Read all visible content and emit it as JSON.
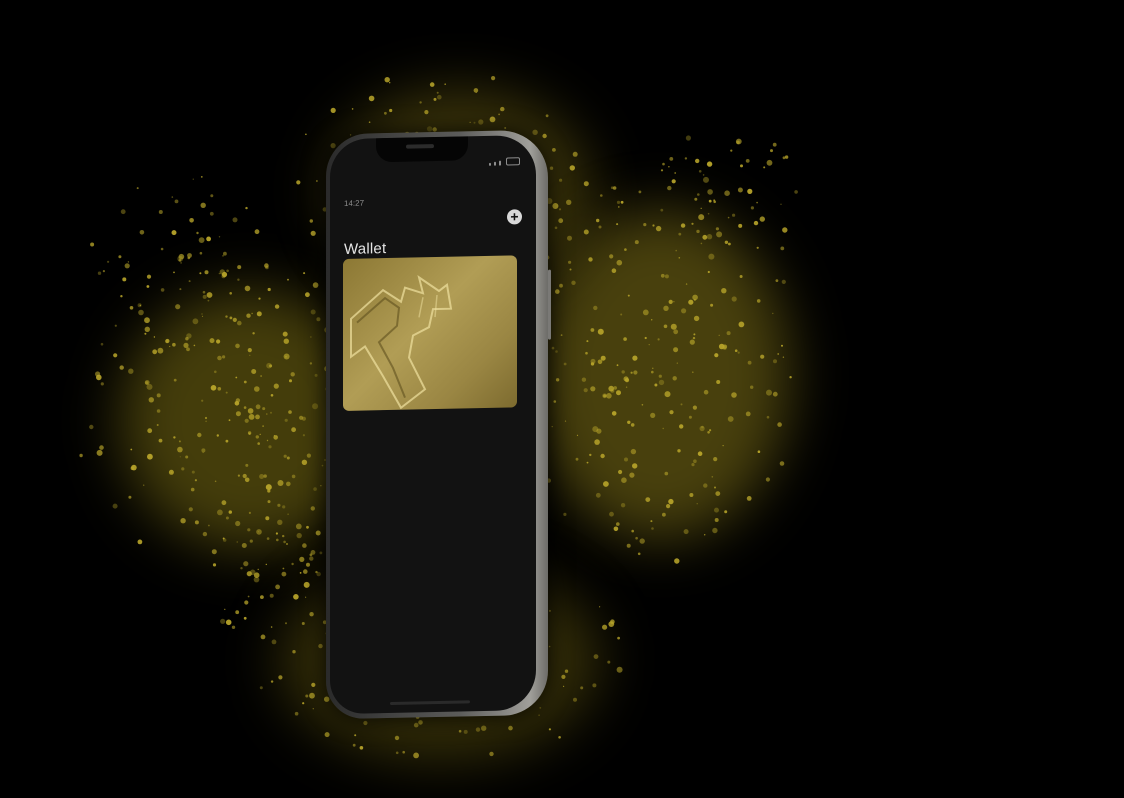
{
  "scene": {
    "background_color": "#000000",
    "dust_color": "#b8a52a"
  },
  "phone": {
    "status_time": "14:27",
    "screen_title": "Wallet",
    "add_button_symbol": "+",
    "add_button_icon": "plus-circle-icon",
    "card_color": "#a8944a"
  }
}
